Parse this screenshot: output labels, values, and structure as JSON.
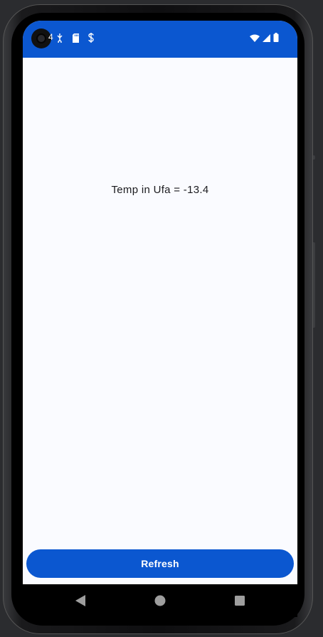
{
  "status_bar": {
    "clock_partial": "4",
    "left_icons": [
      "usb-debug-icon",
      "sd-card-icon",
      "dollar-notification-icon"
    ],
    "right_icons": [
      "wifi-icon",
      "cell-signal-icon",
      "battery-icon"
    ],
    "color": "#0b57d0"
  },
  "main": {
    "temperature_text": "Temp in Ufa = -13.4"
  },
  "actions": {
    "refresh_label": "Refresh",
    "accent_color": "#0b57d0"
  },
  "nav_bar": {
    "buttons": [
      "back-icon",
      "home-icon",
      "recents-icon"
    ]
  }
}
